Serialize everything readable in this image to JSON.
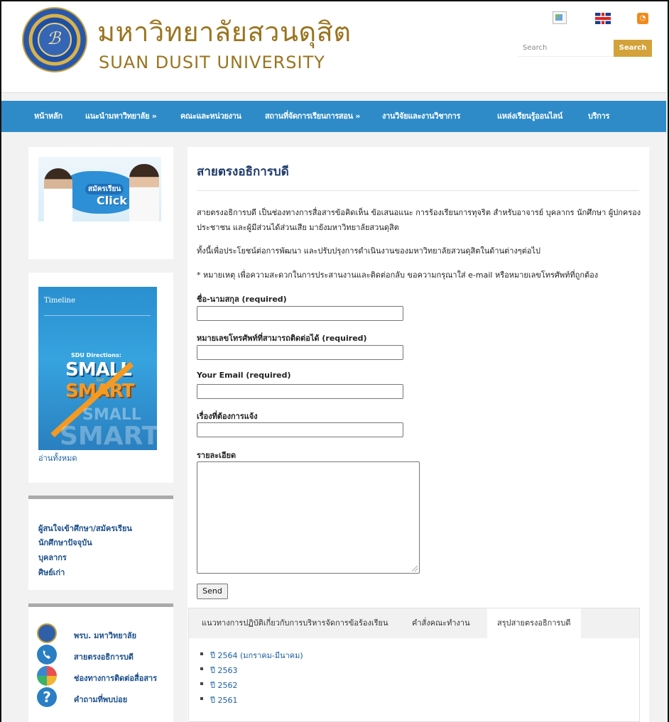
{
  "header": {
    "title_th": "มหาวิทยาลัยสวนดุสิต",
    "title_en": "SUAN DUSIT UNIVERSITY",
    "search_placeholder": "Search",
    "search_button": "Search"
  },
  "nav": {
    "items": [
      {
        "label": "หน้าหลัก"
      },
      {
        "label": "แนะนำมหาวิทยาลัย »"
      },
      {
        "label": "คณะและหน่วยงาน"
      },
      {
        "label": "สถานที่จัดการเรียนการสอน »"
      },
      {
        "label": "งานวิจัยและงานวิชาการ"
      },
      {
        "label": "แหล่งเรียนรู้ออนไลน์"
      },
      {
        "label": "บริการ"
      }
    ]
  },
  "sidebar": {
    "apply_banner": {
      "line1": "สมัครเรียน",
      "line2": "Click"
    },
    "poster": {
      "head": "Timeline",
      "sub": "SDU Directions:",
      "small": "SMALL",
      "but": "but",
      "smart": "SMART",
      "ghost1": "SMALL",
      "ghost2": "SMART"
    },
    "read_all": "อ่านทั้งหมด",
    "links": [
      "ผู้สนใจเข้าศึกษา/สมัครเรียน",
      "นักศึกษาปัจจุบัน",
      "บุคลากร",
      "ศิษย์เก่า"
    ],
    "quick": [
      {
        "label": "พรบ. มหาวิทยาลัย",
        "icon": "seal-icon"
      },
      {
        "label": "สายตรงอธิการบดี",
        "icon": "phone-icon"
      },
      {
        "label": "ช่องทางการติดต่อสื่อสาร",
        "icon": "contact-icon"
      },
      {
        "label": "คำถามที่พบบ่อย",
        "icon": "question-icon"
      }
    ]
  },
  "main": {
    "title": "สายตรงอธิการบดี",
    "para1": "สายตรงอธิการบดี เป็นช่องทางการสื่อสารข้อคิดเห็น ข้อเสนอแนะ การร้องเรียนการทุจริต สำหรับอาจารย์ บุคลากร นักศึกษา ผู้ปกครอง ประชาชน และผู้มีส่วนได้ส่วนเสีย มายังมหาวิทยาลัยสวนดุสิต",
    "para2": "ทั้งนี้เพื่อประโยชน์ต่อการพัฒนา และปรับปรุงการดำเนินงานของมหาวิทยาลัยสวนดุสิตในด้านต่างๆต่อไป",
    "para3": "* หมายเหตุ เพื่อความสะดวกในการประสานงานและติดต่อกลับ ขอความกรุณาใส่ e-mail หรือหมายเลขโทรศัพท์ที่ถูกต้อง",
    "form": {
      "name_label": "ชื่อ-นามสกุล (required)",
      "phone_label": "หมายเลขโทรศัพท์ที่สามารถติดต่อได้ (required)",
      "email_label": "Your Email (required)",
      "subject_label": "เรื่องที่ต้องการแจ้ง",
      "detail_label": "รายละเอียด",
      "send": "Send"
    },
    "tabs": [
      {
        "label": "แนวทางการปฏิบัติเกี่ยวกับการบริหารจัดการข้อร้องเรียน",
        "active": false
      },
      {
        "label": "คำสั่งคณะทำงาน",
        "active": false
      },
      {
        "label": "สรุปสายตรงอธิการบดี",
        "active": true
      }
    ],
    "summary_items": [
      "ปี 2564 (มกราคม-มีนาคม)",
      "ปี 2563",
      "ปี 2562",
      "ปี 2561"
    ]
  },
  "colors": {
    "nav": "#2e8bc7",
    "brand_gold": "#9a7420",
    "search_button": "#d4a23a",
    "link": "#1a5fa0"
  }
}
